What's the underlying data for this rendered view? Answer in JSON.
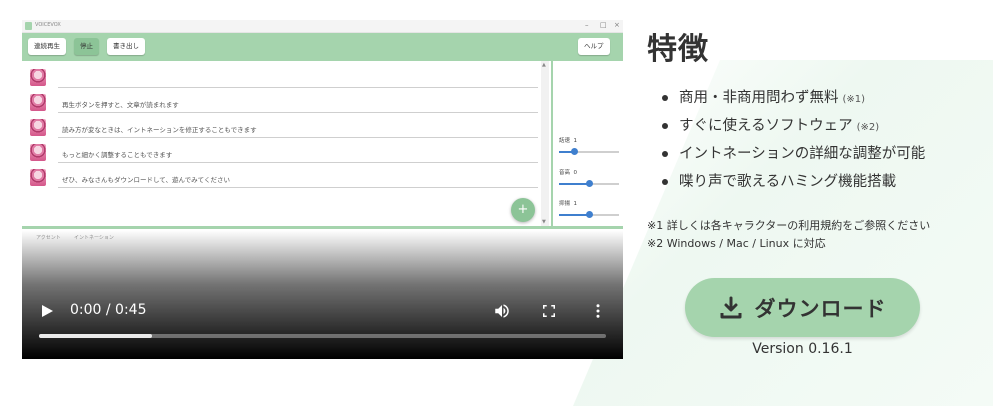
{
  "video": {
    "app": {
      "title": "VOICEVOX",
      "toolbar": {
        "continuous_play": "連続再生",
        "stop": "停止",
        "export": "書き出し",
        "help": "ヘルプ"
      },
      "lines": [
        {
          "text": ""
        },
        {
          "text": "再生ボタンを押すと、文章が読まれます"
        },
        {
          "text": "読み方が変なときは、イントネーションを修正することもできます"
        },
        {
          "text": "もっと細かく調整することもできます"
        },
        {
          "text": "ぜひ、みなさんもダウンロードして、遊んでみてください"
        }
      ],
      "add_button": "+",
      "params": [
        {
          "label": "話速",
          "value": "1",
          "level": 0.25
        },
        {
          "label": "音高",
          "value": "0",
          "level": 0.5
        },
        {
          "label": "抑揚",
          "value": "1",
          "level": 0.5
        }
      ],
      "bottom_tabs": [
        "アクセント",
        "イントネーション"
      ]
    },
    "current_time": "0:00",
    "duration": "0:45",
    "time_display": "0:00 / 0:45",
    "progress_buffered": 0.2,
    "icons": {
      "play": "play-icon",
      "volume": "volume-icon",
      "fullscreen": "fullscreen-icon",
      "more": "more-vert-icon"
    }
  },
  "features": {
    "title": "特徴",
    "items": [
      {
        "text": "商用・非商用問わず無料",
        "note": "(※1)"
      },
      {
        "text": "すぐに使えるソフトウェア",
        "note": "(※2)"
      },
      {
        "text": "イントネーションの詳細な調整が可能",
        "note": ""
      },
      {
        "text": "喋り声で歌えるハミング機能搭載",
        "note": ""
      }
    ],
    "footnotes": [
      "※1 詳しくは各キャラクターの利用規約をご参照ください",
      "※2 Windows / Mac / Linux に対応"
    ]
  },
  "download": {
    "label": "ダウンロード",
    "icon": "download-icon",
    "version": "Version 0.16.1"
  },
  "colors": {
    "accent": "#a5d4ad",
    "text": "#333333",
    "slider": "#3f7fce"
  }
}
